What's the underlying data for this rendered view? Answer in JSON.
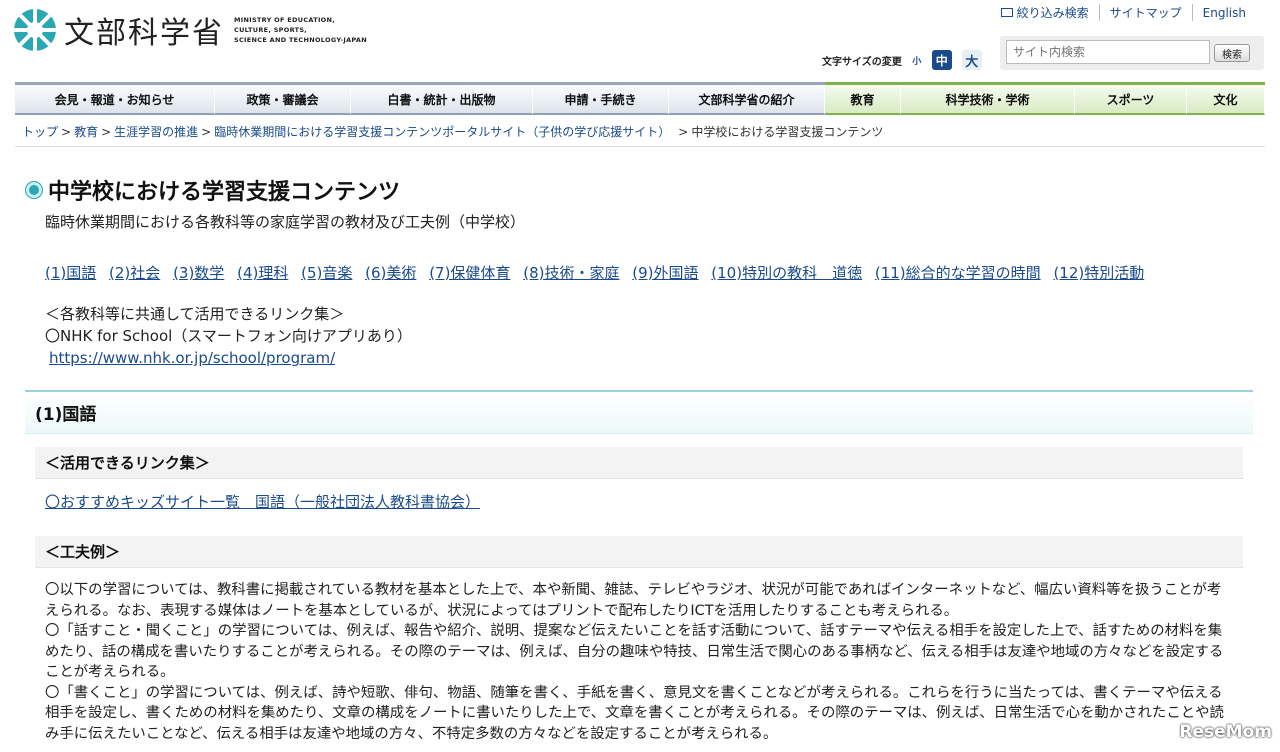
{
  "header": {
    "logo_jp": "文部科学省",
    "logo_en_lines": [
      "MINISTRY OF EDUCATION,",
      "CULTURE, SPORTS,",
      "SCIENCE AND TECHNOLOGY-JAPAN"
    ],
    "util_links": [
      "絞り込み検索",
      "サイトマップ",
      "English"
    ],
    "font_size_label": "文字サイズの変更",
    "font_sizes": [
      "小",
      "中",
      "大"
    ],
    "search_placeholder": "サイト内検索",
    "search_button": "検索"
  },
  "gnav": [
    {
      "label": "会見・報道・お知らせ",
      "green": false
    },
    {
      "label": "政策・審議会",
      "green": false
    },
    {
      "label": "白書・統計・出版物",
      "green": false
    },
    {
      "label": "申請・手続き",
      "green": false
    },
    {
      "label": "文部科学省の紹介",
      "green": false
    },
    {
      "label": "教育",
      "green": true
    },
    {
      "label": "科学技術・学術",
      "green": true
    },
    {
      "label": "スポーツ",
      "green": true
    },
    {
      "label": "文化",
      "green": true
    }
  ],
  "breadcrumb": {
    "links": [
      "トップ",
      "教育",
      "生涯学習の推進",
      "臨時休業期間における学習支援コンテンツポータルサイト（子供の学び応援サイト）"
    ],
    "current": "中学校における学習支援コンテンツ"
  },
  "main": {
    "title": "中学校における学習支援コンテンツ",
    "subtitle": "臨時休業期間における各教科等の家庭学習の教材及び工夫例（中学校）",
    "subject_links": [
      "(1)国語",
      "(2)社会",
      "(3)数学",
      "(4)理科",
      "(5)音楽",
      "(6)美術",
      "(7)保健体育",
      "(8)技術・家庭",
      "(9)外国語",
      "(10)特別の教科　道徳",
      "(11)総合的な学習の時間",
      "(12)特別活動"
    ],
    "common_heading": "＜各教科等に共通して活用できるリンク集＞",
    "common_item": "〇NHK for School（スマートフォン向けアプリあり）",
    "common_url": "https://www.nhk.or.jp/school/program/",
    "section_title": "(1)国語",
    "links_heading": "＜活用できるリンク集＞",
    "kids_link": "〇おすすめキッズサイト一覧　国語（一般社団法人教科書協会）",
    "ideas_heading": "＜工夫例＞",
    "paragraphs": [
      "〇以下の学習については、教科書に掲載されている教材を基本とした上で、本や新聞、雑誌、テレビやラジオ、状況が可能であればインターネットなど、幅広い資料等を扱うことが考えられる。なお、表現する媒体はノートを基本としているが、状況によってはプリントで配布したりICTを活用したりすることも考えられる。",
      "〇「話すこと・聞くこと」の学習については、例えば、報告や紹介、説明、提案など伝えたいことを話す活動について、話すテーマや伝える相手を設定した上で、話すための材料を集めたり、話の構成を書いたりすることが考えられる。その際のテーマは、例えば、自分の趣味や特技、日常生活で関心のある事柄など、伝える相手は友達や地域の方々などを設定することが考えられる。",
      "〇「書くこと」の学習については、例えば、詩や短歌、俳句、物語、随筆を書く、手紙を書く、意見文を書くことなどが考えられる。これらを行うに当たっては、書くテーマや伝える相手を設定し、書くための材料を集めたり、文章の構成をノートに書いたりした上で、文章を書くことが考えられる。その際のテーマは、例えば、日常生活で心を動かされたことや読み手に伝えたいことなど、伝える相手は友達や地域の方々、不特定多数の方々などを設定することが考えられる。"
    ]
  },
  "watermark": "ReseMom"
}
